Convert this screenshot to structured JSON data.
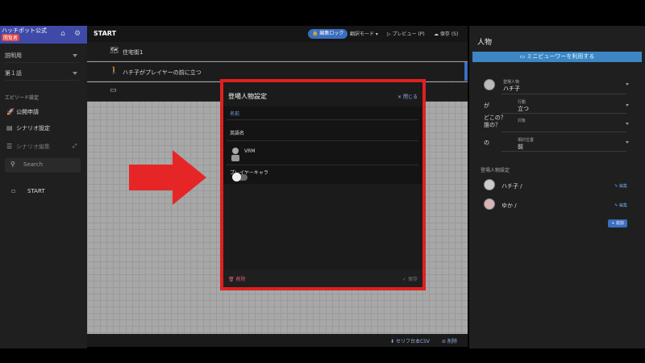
{
  "brand": {
    "title": "ハッチポット公式",
    "badge": "閲覧者"
  },
  "icons": {
    "home": "home-icon",
    "settings": "gear-icon"
  },
  "sidebar": {
    "select1": "説明用",
    "select2": "第１話",
    "section": "エピソード設定",
    "items": [
      {
        "icon": "rocket-icon",
        "label": "公開申請"
      },
      {
        "icon": "document-icon",
        "label": "シナリオ設定"
      },
      {
        "icon": "list-icon",
        "label": "シナリオ編集"
      }
    ],
    "search_placeholder": "Search",
    "tree_item": "START"
  },
  "topbar": {
    "title": "START",
    "lock_label": "編集ロック",
    "translate_mode": "翻訳モード",
    "preview": "プレビュー (P)",
    "save": "保存 (S)"
  },
  "scene_rows": [
    {
      "icon": "map-icon",
      "text": "住宅街1"
    },
    {
      "icon": "walking-person-icon",
      "text": "ハチ子がプレイヤーの前に立つ"
    },
    {
      "icon": "terminal-icon",
      "text": ""
    }
  ],
  "bottombar": {
    "csv": "セリフ台本CSV",
    "delete": "削除"
  },
  "right_panel": {
    "title": "人物",
    "preview_button": "ミニビューワーを利用する",
    "fields": {
      "character_label": "登場人物",
      "character_value": "ハチ子",
      "particle_ga": "が",
      "action_label": "行動",
      "action_value": "立つ",
      "where_who": "どこの？ 誰の？",
      "target_label": "対象",
      "particle_no": "の",
      "relative_label": "相対位置",
      "relative_value": "前"
    },
    "characters_section": "登場人物設定",
    "characters": [
      {
        "name": "ハチ子 /",
        "edit": "編集"
      },
      {
        "name": "ゆか /",
        "edit": "編集"
      }
    ],
    "add_button": "+ 追加"
  },
  "modal": {
    "title": "登場人物設定",
    "close": "閉じる",
    "tab_name": "名前",
    "english_name": "英語名",
    "vrm": "VRM",
    "player_character": "プレイヤーキャラ",
    "player_character_on": false,
    "delete": "削除",
    "save": "保存"
  },
  "colors": {
    "accent": "#3a6ec0",
    "highlight_frame": "#e02020",
    "arrow": "#e62626",
    "brand_bar": "#3f4aa8"
  }
}
